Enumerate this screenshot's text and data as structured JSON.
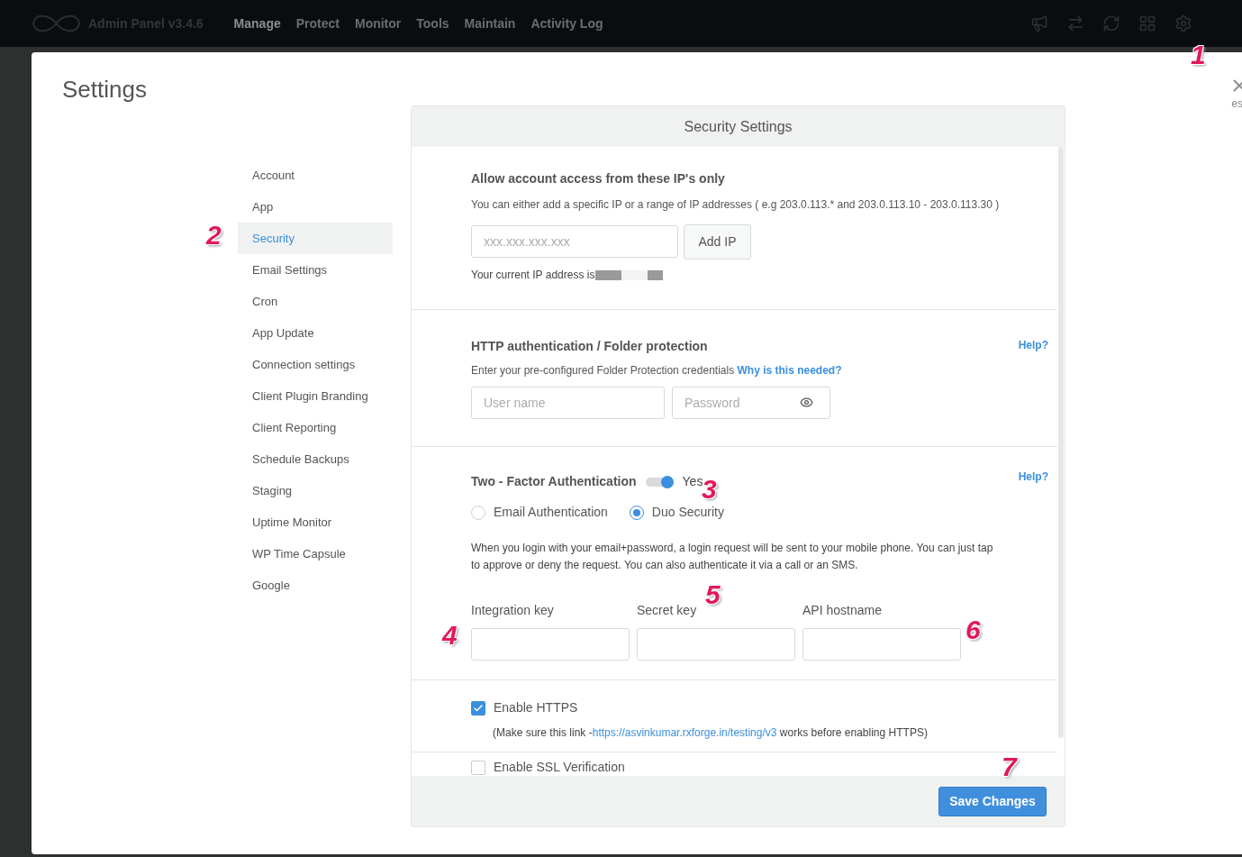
{
  "topbar": {
    "brand": "Admin Panel v3.4.6",
    "menu": [
      {
        "label": "Manage",
        "selected": true
      },
      {
        "label": "Protect",
        "selected": false
      },
      {
        "label": "Monitor",
        "selected": false
      },
      {
        "label": "Tools",
        "selected": false
      },
      {
        "label": "Maintain",
        "selected": false
      },
      {
        "label": "Activity Log",
        "selected": false
      }
    ]
  },
  "modal": {
    "title": "Settings",
    "close_hint": "es",
    "sidebar": [
      {
        "label": "Account",
        "selected": false
      },
      {
        "label": "App",
        "selected": false
      },
      {
        "label": "Security",
        "selected": true
      },
      {
        "label": "Email Settings",
        "selected": false
      },
      {
        "label": "Cron",
        "selected": false
      },
      {
        "label": "App Update",
        "selected": false
      },
      {
        "label": "Connection settings",
        "selected": false
      },
      {
        "label": "Client Plugin Branding",
        "selected": false
      },
      {
        "label": "Client Reporting",
        "selected": false
      },
      {
        "label": "Schedule Backups",
        "selected": false
      },
      {
        "label": "Staging",
        "selected": false
      },
      {
        "label": "Uptime Monitor",
        "selected": false
      },
      {
        "label": "WP Time Capsule",
        "selected": false
      },
      {
        "label": "Google",
        "selected": false
      }
    ],
    "panel": {
      "title": "Security Settings",
      "ip": {
        "heading": "Allow account access from these IP's only",
        "description": "You can either add a specific IP or a range of IP addresses ( e.g 203.0.113.* and 203.0.113.10 - 203.0.113.30 )",
        "placeholder": "xxx.xxx.xxx.xxx",
        "button": "Add IP",
        "current": "Your current IP address is"
      },
      "http": {
        "heading": "HTTP authentication / Folder protection",
        "help": "Help?",
        "description": "Enter your pre-configured Folder Protection credentials",
        "link": "Why is this needed?",
        "username_placeholder": "User name",
        "password_placeholder": "Password"
      },
      "twofa": {
        "heading": "Two - Factor Authentication",
        "on": true,
        "toggle_label": "Yes",
        "help": "Help?",
        "options": [
          {
            "label": "Email Authentication",
            "selected": false
          },
          {
            "label": "Duo Security",
            "selected": true
          }
        ],
        "description": "When you login with your email+password, a login request will be sent to your mobile phone. You can just tap to approve or deny the request. You can also authenticate it via a call or an SMS.",
        "fields": [
          {
            "label": "Integration key"
          },
          {
            "label": "Secret key"
          },
          {
            "label": "API hostname"
          }
        ]
      },
      "https": {
        "label": "Enable HTTPS",
        "checked": true,
        "note_before": "(Make sure this link -",
        "link": "https://asvinkumar.rxforge.in/testing/v3",
        "note_after": "works before enabling HTTPS)"
      },
      "ssl": {
        "label": "Enable SSL Verification",
        "checked": false
      },
      "save": "Save Changes"
    }
  },
  "callouts": [
    {
      "label": "1"
    },
    {
      "label": "2"
    },
    {
      "label": "3"
    },
    {
      "label": "4"
    },
    {
      "label": "5"
    },
    {
      "label": "6"
    },
    {
      "label": "7"
    }
  ]
}
